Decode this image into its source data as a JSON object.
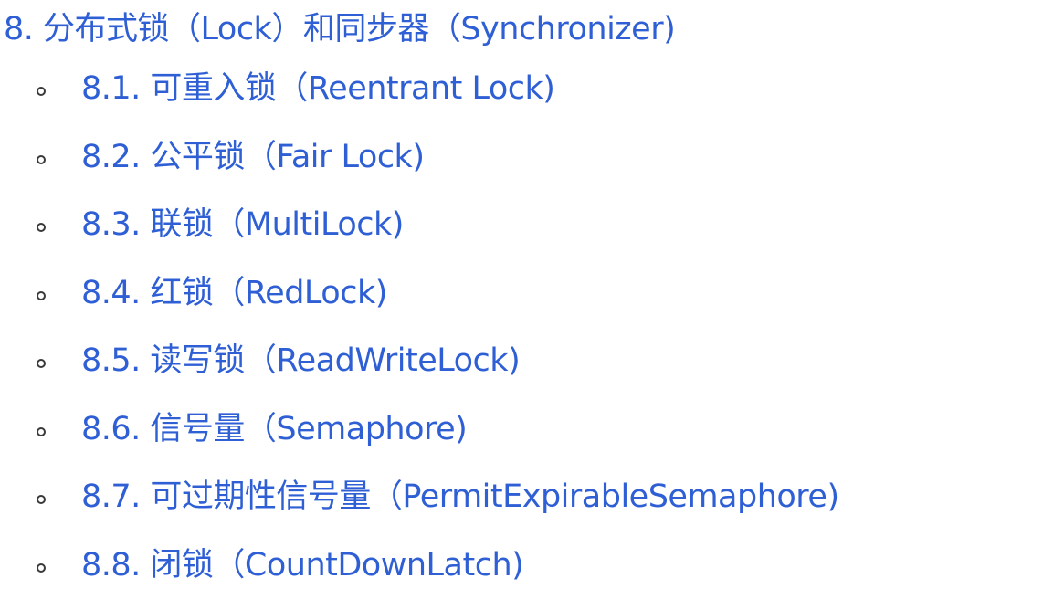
{
  "section": {
    "title": "8. 分布式锁（Lock）和同步器（Synchronizer)"
  },
  "items": [
    "8.1. 可重入锁（Reentrant Lock)",
    "8.2. 公平锁（Fair Lock)",
    "8.3. 联锁（MultiLock)",
    "8.4. 红锁（RedLock)",
    "8.5. 读写锁（ReadWriteLock)",
    "8.6. 信号量（Semaphore)",
    "8.7. 可过期性信号量（PermitExpirableSemaphore)",
    "8.8. 闭锁（CountDownLatch)"
  ],
  "colors": {
    "link": "#2f5fd4",
    "bullet": "#3a3a3a",
    "background": "#ffffff"
  }
}
